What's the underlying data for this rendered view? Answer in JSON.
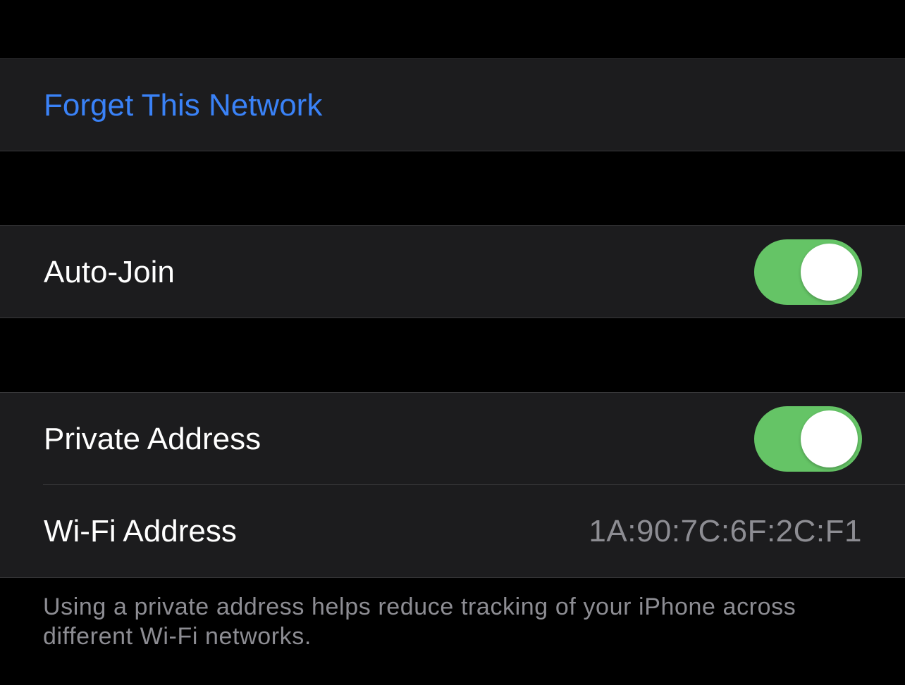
{
  "forget_group": {
    "forget_label": "Forget This Network"
  },
  "autojoin_group": {
    "label": "Auto-Join",
    "enabled": true
  },
  "privacy_group": {
    "private_address_label": "Private Address",
    "private_address_enabled": true,
    "wifi_address_label": "Wi-Fi Address",
    "wifi_address_value": "1A:90:7C:6F:2C:F1"
  },
  "footer": {
    "note": "Using a private address helps reduce tracking of your iPhone across different Wi-Fi networks."
  },
  "colors": {
    "background": "#000000",
    "cell_background": "#1c1c1e",
    "separator": "#38383a",
    "link_blue": "#3a82f7",
    "toggle_on_green": "#65c466",
    "secondary_text": "#8d8d93"
  }
}
